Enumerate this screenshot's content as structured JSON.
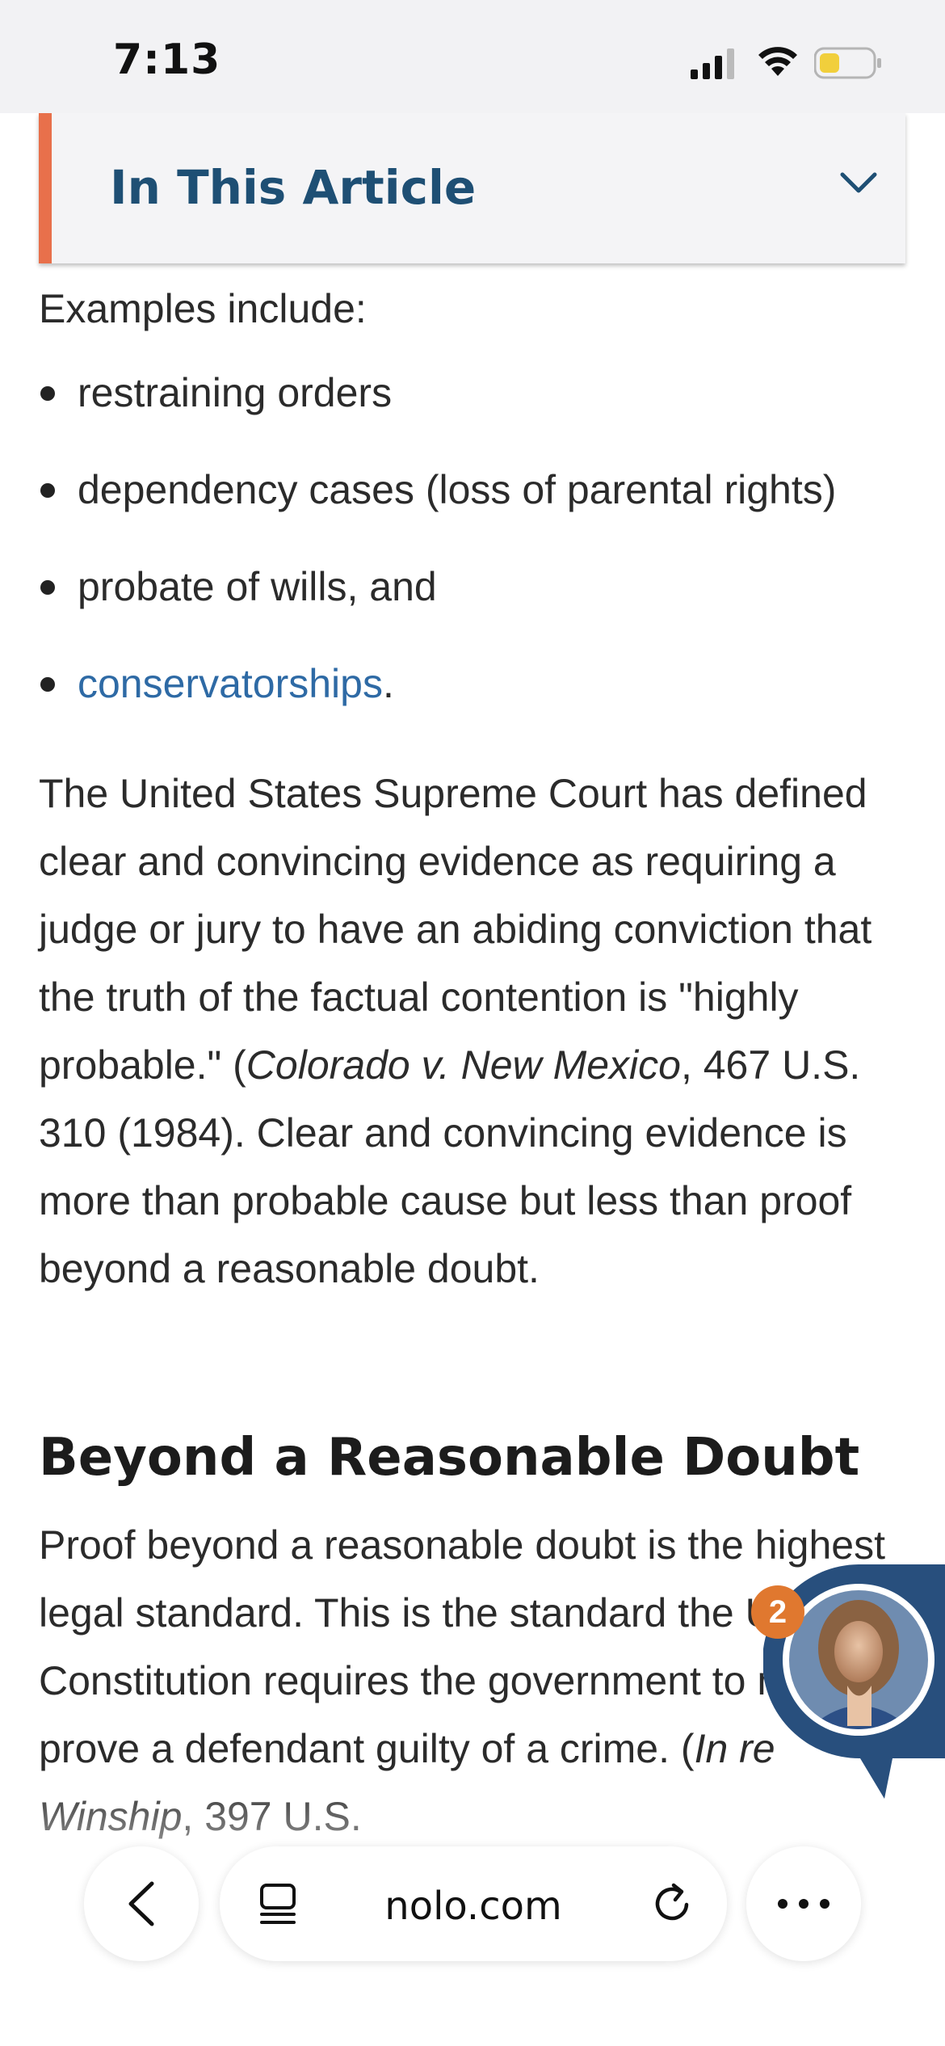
{
  "status_bar": {
    "time": "7:13"
  },
  "article_toc": {
    "title": "In This Article"
  },
  "article": {
    "intro": "Examples include:",
    "bullets": [
      {
        "text": "restraining orders"
      },
      {
        "text": "dependency cases (loss of parental rights)"
      },
      {
        "text": "probate of wills, and"
      },
      {
        "text": "conservatorships",
        "link": true,
        "suffix": "."
      }
    ],
    "paragraph1": {
      "part1": "The United States Supreme Court has defined clear and convincing evidence as requiring a judge or jury to have an abiding conviction that the truth of the factual contention is \"highly probable.\" (",
      "case": "Colorado v. New Mexico",
      "part2": ", 467 U.S. 310 (1984). Clear and convincing evidence is more than probable cause but less than proof beyond a reasonable doubt."
    },
    "section_heading": "Beyond a Reasonable Doubt",
    "paragraph2": {
      "part1": "Proof beyond a reasonable doubt is the highest legal standard. This is the standard the U.S. Constitution requires the government to meet to prove a defendant guilty of a crime. (",
      "case": "In re Winship",
      "part2": ", 397 U.S."
    }
  },
  "chat_widget": {
    "badge_count": "2",
    "avatar": "avatar-photo"
  },
  "browser": {
    "url": "nolo.com"
  },
  "colors": {
    "accent_orange": "#e8704b",
    "heading_blue": "#1e4f74",
    "link_blue": "#2e6aa5",
    "chat_blue": "#284f7d"
  }
}
